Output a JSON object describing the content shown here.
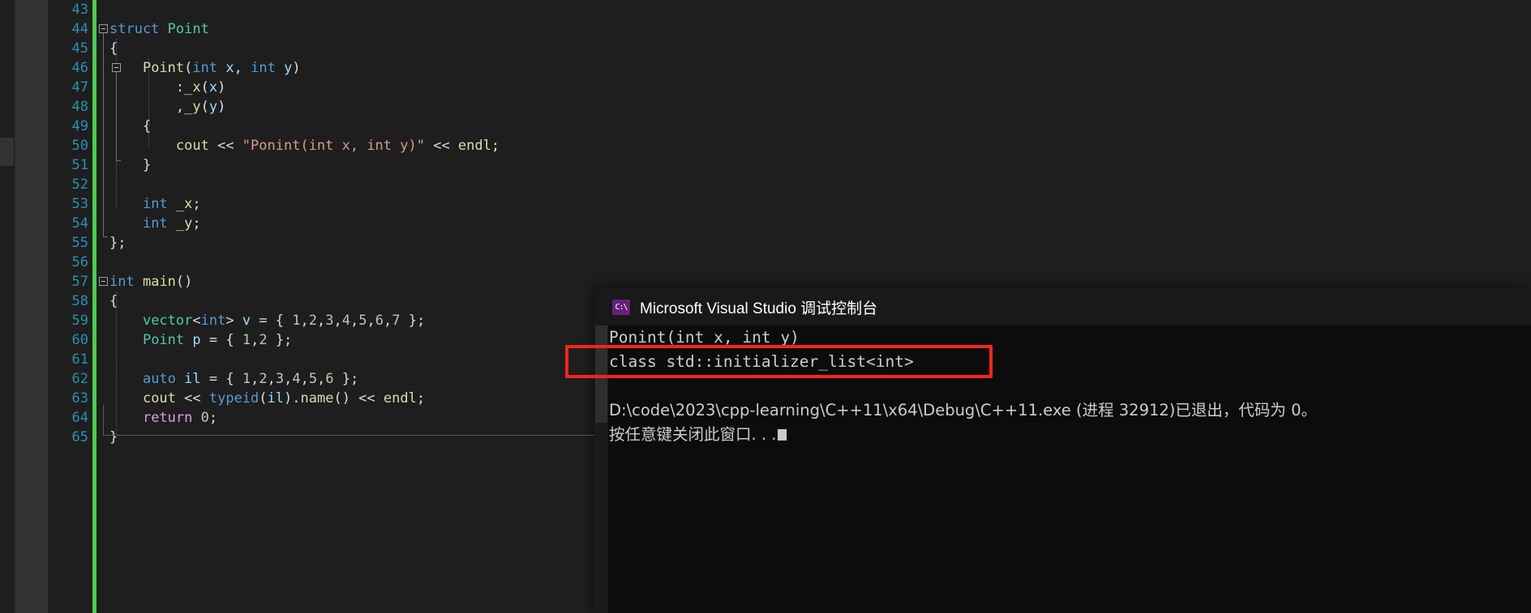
{
  "editor": {
    "first_line_number": 43,
    "lines": [
      {
        "n": 43,
        "text": ""
      },
      {
        "n": 44,
        "text": "struct Point"
      },
      {
        "n": 45,
        "text": "{"
      },
      {
        "n": 46,
        "text": "    Point(int x, int y)"
      },
      {
        "n": 47,
        "text": "        :_x(x)"
      },
      {
        "n": 48,
        "text": "        ,_y(y)"
      },
      {
        "n": 49,
        "text": "    {"
      },
      {
        "n": 50,
        "text": "        cout << \"Ponint(int x, int y)\" << endl;"
      },
      {
        "n": 51,
        "text": "    }"
      },
      {
        "n": 52,
        "text": ""
      },
      {
        "n": 53,
        "text": "    int _x;"
      },
      {
        "n": 54,
        "text": "    int _y;"
      },
      {
        "n": 55,
        "text": "};"
      },
      {
        "n": 56,
        "text": ""
      },
      {
        "n": 57,
        "text": "int main()"
      },
      {
        "n": 58,
        "text": "{"
      },
      {
        "n": 59,
        "text": "    vector<int> v = { 1,2,3,4,5,6,7 };"
      },
      {
        "n": 60,
        "text": "    Point p = { 1,2 };"
      },
      {
        "n": 61,
        "text": ""
      },
      {
        "n": 62,
        "text": "    auto il = { 1,2,3,4,5,6 };"
      },
      {
        "n": 63,
        "text": "    cout << typeid(il).name() << endl;"
      },
      {
        "n": 64,
        "text": "    return 0;"
      },
      {
        "n": 65,
        "text": "}"
      }
    ],
    "colors": {
      "background": "#1e1e1e",
      "line_number": "#2b91af",
      "keyword": "#569cd6",
      "control_keyword": "#d8a0df",
      "type": "#4ec9b0",
      "string": "#d69d85",
      "number": "#b5cea8",
      "function": "#dcdcaa",
      "variable": "#9cdcfe",
      "plain": "#dcdcdc",
      "change_bar": "#4ec94e"
    }
  },
  "console": {
    "title": "Microsoft Visual Studio 调试控制台",
    "app_icon_glyph": "C:\\",
    "background": "#0c0c0c",
    "text_color": "#cccccc",
    "output_lines": [
      "Ponint(int x, int y)",
      "class std::initializer_list<int>",
      "",
      "D:\\code\\2023\\cpp-learning\\C++11\\x64\\Debug\\C++11.exe (进程 32912)已退出，代码为 0。",
      "按任意键关闭此窗口. . ."
    ]
  },
  "annotation": {
    "shape": "rectangle",
    "color": "#f4241e",
    "highlights_text": "class std::initializer_list<int>"
  }
}
